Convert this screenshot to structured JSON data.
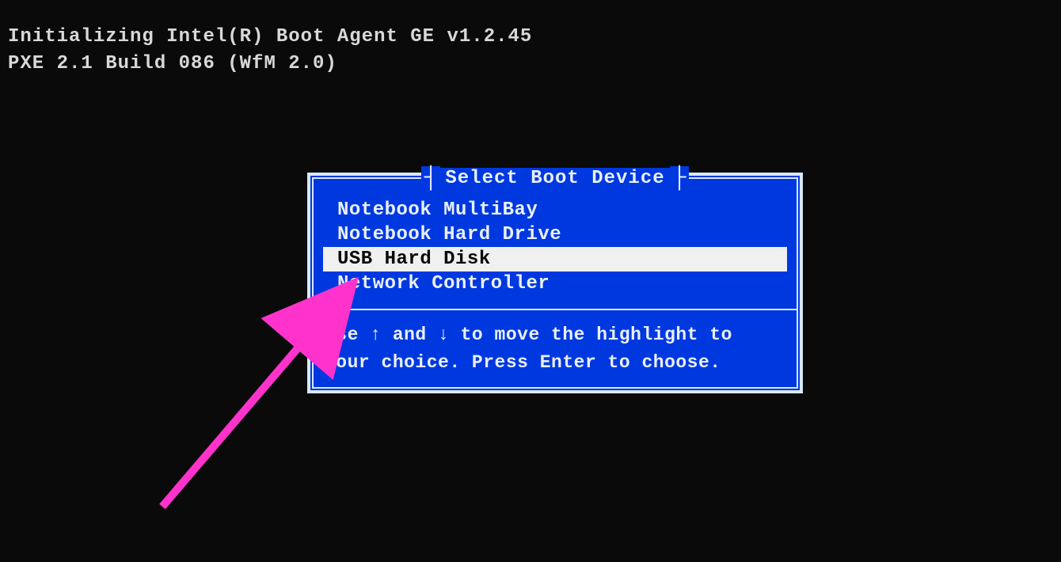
{
  "boot_messages": {
    "line1": "Initializing Intel(R) Boot Agent GE v1.2.45",
    "line2": "PXE 2.1 Build 086 (WfM 2.0)"
  },
  "dialog": {
    "title": "Select Boot Device",
    "devices": [
      {
        "label": "Notebook MultiBay",
        "selected": false
      },
      {
        "label": "Notebook Hard Drive",
        "selected": false
      },
      {
        "label": "USB Hard Disk",
        "selected": true
      },
      {
        "label": "Network Controller",
        "selected": false
      }
    ],
    "instructions": "Use ↑ and ↓ to move the highlight to your choice.  Press Enter to choose."
  },
  "annotation": {
    "arrow_color": "#ff33cc"
  }
}
